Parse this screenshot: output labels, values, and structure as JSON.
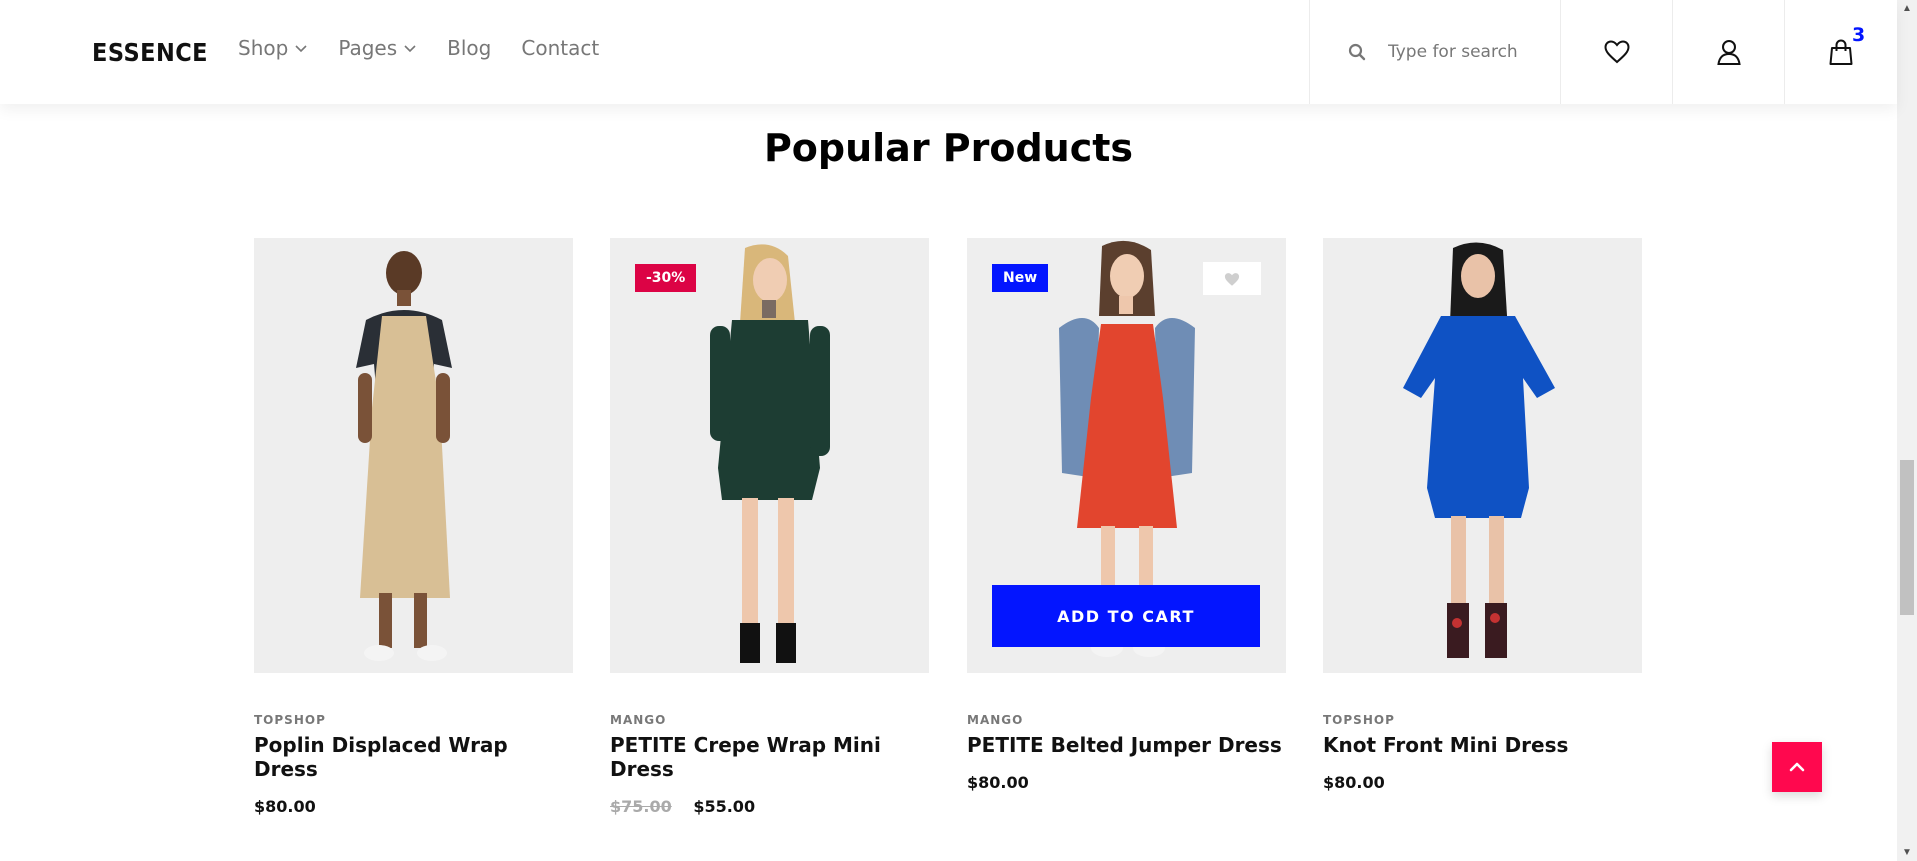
{
  "header": {
    "logo": "ESSENCE",
    "nav": [
      {
        "label": "Shop",
        "has_dropdown": true
      },
      {
        "label": "Pages",
        "has_dropdown": true
      },
      {
        "label": "Blog",
        "has_dropdown": false
      },
      {
        "label": "Contact",
        "has_dropdown": false
      }
    ],
    "search": {
      "placeholder": "Type for search",
      "value": ""
    },
    "icons": [
      "heart-icon",
      "user-icon",
      "bag-icon"
    ],
    "cart_count": "3"
  },
  "section": {
    "title": "Popular Products"
  },
  "products": [
    {
      "brand": "TOPSHOP",
      "name": "Poplin Displaced Wrap Dress",
      "price": "$80.00",
      "old_price": "",
      "badge": "",
      "dress_color": "#d8bf95"
    },
    {
      "brand": "MANGO",
      "name": "PETITE Crepe Wrap Mini Dress",
      "price": "$55.00",
      "old_price": "$75.00",
      "badge": "-30%",
      "dress_color": "#1d3d33"
    },
    {
      "brand": "MANGO",
      "name": "PETITE Belted Jumper Dress",
      "price": "$80.00",
      "old_price": "",
      "badge": "New",
      "dress_color": "#e2452e",
      "add_to_cart": "ADD TO CART"
    },
    {
      "brand": "TOPSHOP",
      "name": "Knot Front Mini Dress",
      "price": "$80.00",
      "old_price": "",
      "badge": "",
      "dress_color": "#0f52c4"
    }
  ],
  "colors": {
    "accent": "#0315ff",
    "sale": "#dc0345",
    "to_top": "#ff084e"
  }
}
